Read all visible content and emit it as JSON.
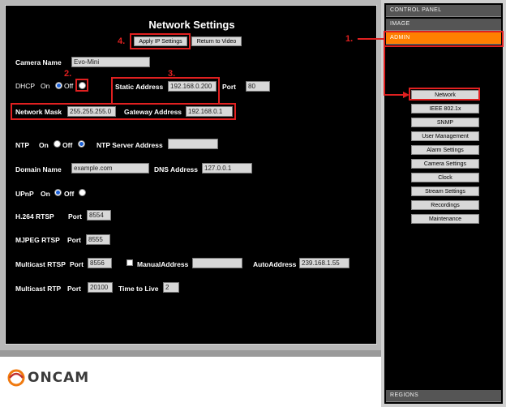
{
  "page": {
    "title": "Network Settings",
    "apply_button": "Apply IP Settings",
    "return_button": "Return to Video"
  },
  "form": {
    "camera_name_label": "Camera Name",
    "camera_name_value": "Evo-Mini",
    "dhcp_label": "DHCP",
    "on_label": "On",
    "off_label": "Off",
    "static_address_label": "Static Address",
    "static_address_value": "192.168.0.200",
    "port_label": "Port",
    "port_value": "80",
    "network_mask_label": "Network Mask",
    "network_mask_value": "255.255.255.0",
    "gateway_label": "Gateway Address",
    "gateway_value": "192.168.0.1",
    "ntp_label": "NTP",
    "ntp_server_label": "NTP Server Address",
    "ntp_server_value": "",
    "domain_name_label": "Domain Name",
    "domain_name_value": "example.com",
    "dns_label": "DNS Address",
    "dns_value": "127.0.0.1",
    "upnp_label": "UPnP",
    "h264_label": "H.264 RTSP",
    "h264_port_label": "Port",
    "h264_port_value": "8554",
    "mjpeg_label": "MJPEG RTSP",
    "mjpeg_port_label": "Port",
    "mjpeg_port_value": "8555",
    "mcast_rtsp_label": "Multicast RTSP",
    "mcast_rtsp_port_label": "Port",
    "mcast_rtsp_port_value": "8556",
    "manual_address_label": "ManualAddress",
    "manual_address_value": "",
    "auto_address_label": "AutoAddress",
    "auto_address_value": "239.168.1.55",
    "mcast_rtp_label": "Multicast RTP",
    "mcast_rtp_port_label": "Port",
    "mcast_rtp_port_value": "20100",
    "ttl_label": "Time to Live",
    "ttl_value": "2"
  },
  "annotations": {
    "n1": "1.",
    "n2": "2.",
    "n3": "3.",
    "n4": "4."
  },
  "sidebar": {
    "tabs": [
      "CONTROL PANEL",
      "IMAGE",
      "ADMIN"
    ],
    "active_tab": "ADMIN",
    "buttons": [
      "Network",
      "IEEE 802.1x",
      "SNMP",
      "User Management",
      "Alarm Settings",
      "Camera Settings",
      "Clock",
      "Stream Settings",
      "Recordings",
      "Maintenance"
    ],
    "regions_tab": "REGIONS"
  },
  "footer": {
    "logo_text": "ONCAM"
  },
  "colors": {
    "accent": "#ff7f00",
    "highlight": "#e02020",
    "radio_selected": "#1a5fd6"
  }
}
